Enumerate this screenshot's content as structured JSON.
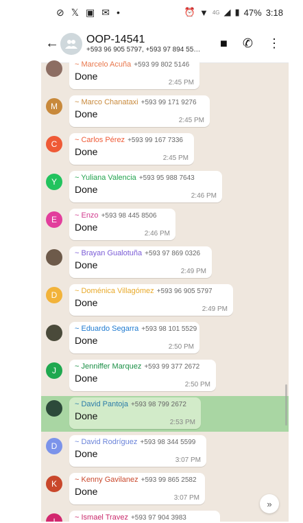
{
  "status": {
    "left_icons": [
      "alarm-icon",
      "x-icon",
      "linkedin-icon",
      "mail-icon",
      "dot-icon"
    ],
    "battery": "47%",
    "time": "3:18",
    "network": "4G"
  },
  "header": {
    "title": "OOP-14541",
    "subtitle": "+593 96 905 5797, +593 97 894 55…"
  },
  "colors": {
    "chat_bg": "#efe7de",
    "highlight": "#a9d6a3"
  },
  "messages": [
    {
      "sender": "~ Marcelo Acuña",
      "phone": "+593 99 802 5146",
      "text": "Done",
      "time": "2:45 PM",
      "avatar": "",
      "avatar_color": "#8d6e63",
      "sender_color": "#e8764b"
    },
    {
      "sender": "~ Marco Chanataxi",
      "phone": "+593 99 171 9276",
      "text": "Done",
      "time": "2:45 PM",
      "avatar": "M",
      "avatar_color": "#c8893b",
      "sender_color": "#c8893b"
    },
    {
      "sender": "~ Carlos Pérez",
      "phone": "+593 99 167 7336",
      "text": "Done",
      "time": "2:45 PM",
      "avatar": "C",
      "avatar_color": "#ef5a36",
      "sender_color": "#ef5a36"
    },
    {
      "sender": "~ Yuliana Valencia",
      "phone": "+593 95 988 7643",
      "text": "Done",
      "time": "2:46 PM",
      "avatar": "Y",
      "avatar_color": "#22c35e",
      "sender_color": "#22a34e"
    },
    {
      "sender": "~ Enzo",
      "phone": "+593 98 445 8506",
      "text": "Done",
      "time": "2:46 PM",
      "avatar": "E",
      "avatar_color": "#e23e9c",
      "sender_color": "#d13a8e"
    },
    {
      "sender": "~ Brayan Gualotuña",
      "phone": "+593 97 869 0326",
      "text": "Done",
      "time": "2:49 PM",
      "avatar": "",
      "avatar_color": "#6d5a4a",
      "sender_color": "#7a5bd6"
    },
    {
      "sender": "~ Doménica Villagómez",
      "phone": "+593 96 905 5797",
      "text": "Done",
      "time": "2:49 PM",
      "avatar": "D",
      "avatar_color": "#f2b33a",
      "sender_color": "#e8a92a"
    },
    {
      "sender": "~ Eduardo Segarra",
      "phone": "+593 98 101 5529",
      "text": "Done",
      "time": "2:50 PM",
      "avatar": "",
      "avatar_color": "#4a4a3a",
      "sender_color": "#1e7ad0"
    },
    {
      "sender": "~ Jenniffer Marquez",
      "phone": "+593 99 377 2672",
      "text": "Done",
      "time": "2:50 PM",
      "avatar": "J",
      "avatar_color": "#1fa84f",
      "sender_color": "#1a8f45"
    },
    {
      "sender": "~ David Pantoja",
      "phone": "+593 98 799 2672",
      "text": "Done",
      "time": "2:53 PM",
      "avatar": "",
      "avatar_color": "#2c4a3a",
      "sender_color": "#2a7ba8",
      "highlight": true
    },
    {
      "sender": "~ David Rodríguez",
      "phone": "+593 98 344 5599",
      "text": "Done",
      "time": "3:07 PM",
      "avatar": "D",
      "avatar_color": "#7b93ea",
      "sender_color": "#6a83d9"
    },
    {
      "sender": "~ Kenny Gavilanez",
      "phone": "+593 99 865 2582",
      "text": "Done",
      "time": "3:07 PM",
      "avatar": "K",
      "avatar_color": "#c9472b",
      "sender_color": "#c9472b"
    },
    {
      "sender": "~ Ismael Travez",
      "phone": "+593 97 904 3983",
      "text": "",
      "time": "",
      "avatar": "I",
      "avatar_color": "#d2286e",
      "sender_color": "#c9286a"
    }
  ]
}
